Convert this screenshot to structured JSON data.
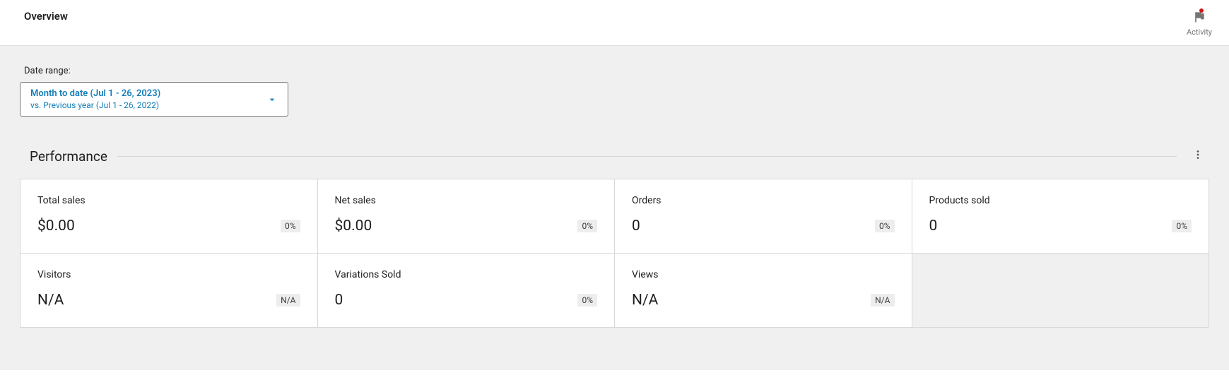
{
  "header": {
    "title": "Overview",
    "activity_label": "Activity"
  },
  "date_range": {
    "label": "Date range:",
    "primary": "Month to date (Jul 1 - 26, 2023)",
    "secondary": "vs. Previous year (Jul 1 - 26, 2022)"
  },
  "performance": {
    "title": "Performance",
    "cards": [
      {
        "label": "Total sales",
        "value": "$0.00",
        "delta": "0%"
      },
      {
        "label": "Net sales",
        "value": "$0.00",
        "delta": "0%"
      },
      {
        "label": "Orders",
        "value": "0",
        "delta": "0%"
      },
      {
        "label": "Products sold",
        "value": "0",
        "delta": "0%"
      },
      {
        "label": "Visitors",
        "value": "N/A",
        "delta": "N/A"
      },
      {
        "label": "Variations Sold",
        "value": "0",
        "delta": "0%"
      },
      {
        "label": "Views",
        "value": "N/A",
        "delta": "N/A"
      }
    ]
  }
}
